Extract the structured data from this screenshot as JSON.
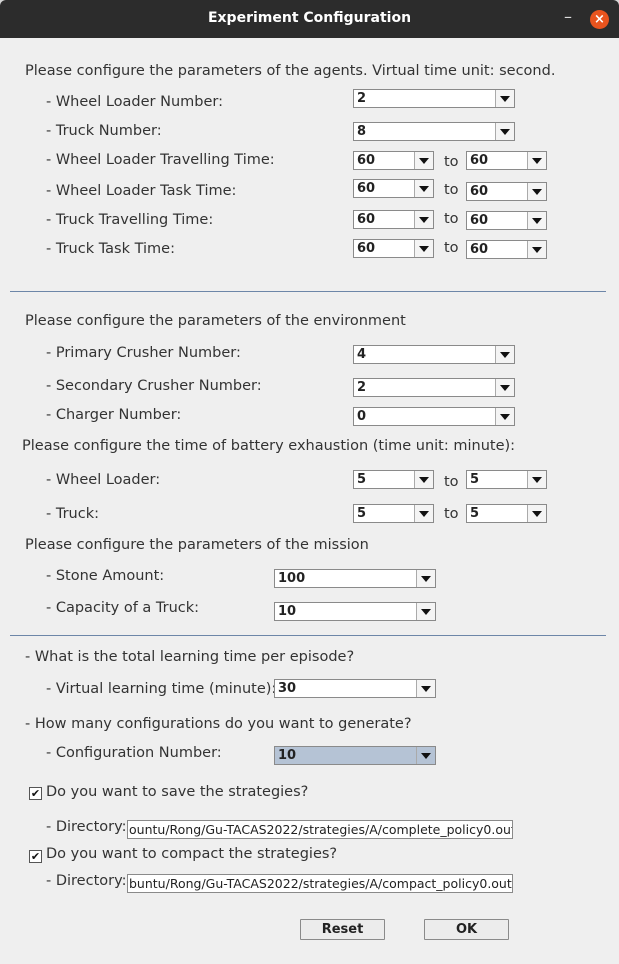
{
  "window": {
    "title": "Experiment Configuration",
    "minimize_glyph": "–",
    "close_glyph": "×"
  },
  "agents": {
    "heading": "Please configure the parameters of the agents. Virtual time unit: second.",
    "wheel_loader_number": {
      "label": "- Wheel Loader Number:",
      "value": "2"
    },
    "truck_number": {
      "label": "- Truck Number:",
      "value": "8"
    },
    "wl_travel_time": {
      "label": "- Wheel Loader Travelling Time:",
      "from": "60",
      "to_label": "to",
      "to": "60"
    },
    "wl_task_time": {
      "label": "- Wheel Loader Task Time:",
      "from": "60",
      "to_label": "to",
      "to": "60"
    },
    "truck_travel_time": {
      "label": "- Truck Travelling Time:",
      "from": "60",
      "to_label": "to",
      "to": "60"
    },
    "truck_task_time": {
      "label": "- Truck Task Time:",
      "from": "60",
      "to_label": "to",
      "to": "60"
    }
  },
  "environment": {
    "heading": "Please configure the parameters of the environment",
    "primary_crusher": {
      "label": "- Primary Crusher Number:",
      "value": "4"
    },
    "secondary_crusher": {
      "label": "- Secondary Crusher Number:",
      "value": "2"
    },
    "charger": {
      "label": "- Charger Number:",
      "value": "0"
    }
  },
  "battery": {
    "heading": "Please configure the time of battery exhaustion (time unit: minute):",
    "wheel_loader": {
      "label": "- Wheel Loader:",
      "from": "5",
      "to_label": "to",
      "to": "5"
    },
    "truck": {
      "label": "- Truck:",
      "from": "5",
      "to_label": "to",
      "to": "5"
    }
  },
  "mission": {
    "heading": "Please configure the parameters of the mission",
    "stone_amount": {
      "label": "- Stone Amount:",
      "value": "100"
    },
    "truck_capacity": {
      "label": "- Capacity of a Truck:",
      "value": "10"
    }
  },
  "learning": {
    "question": "- What is the total learning time per episode?",
    "virtual_time": {
      "label": "- Virtual learning time (minute):",
      "value": "30"
    }
  },
  "configs": {
    "question": "- How many configurations do you want to generate?",
    "number": {
      "label": "- Configuration Number:",
      "value": "10"
    }
  },
  "save": {
    "checked": true,
    "label": "Do you want to save the strategies?",
    "dir_label": "- Directory:",
    "dir_value": "ountu/Rong/Gu-TACAS2022/strategies/A/complete_policy0.out"
  },
  "compact": {
    "checked": true,
    "label": "Do you want to compact the strategies?",
    "dir_label": "- Directory:",
    "dir_value": "buntu/Rong/Gu-TACAS2022/strategies/A/compact_policy0.out"
  },
  "buttons": {
    "reset": "Reset",
    "ok": "OK"
  },
  "colors": {
    "titlebar": "#2c2c2c",
    "close_button": "#e9541e",
    "separator": "#6d86a8",
    "selected_combo": "#b5c3d5"
  },
  "checkmark_glyph": "✔"
}
